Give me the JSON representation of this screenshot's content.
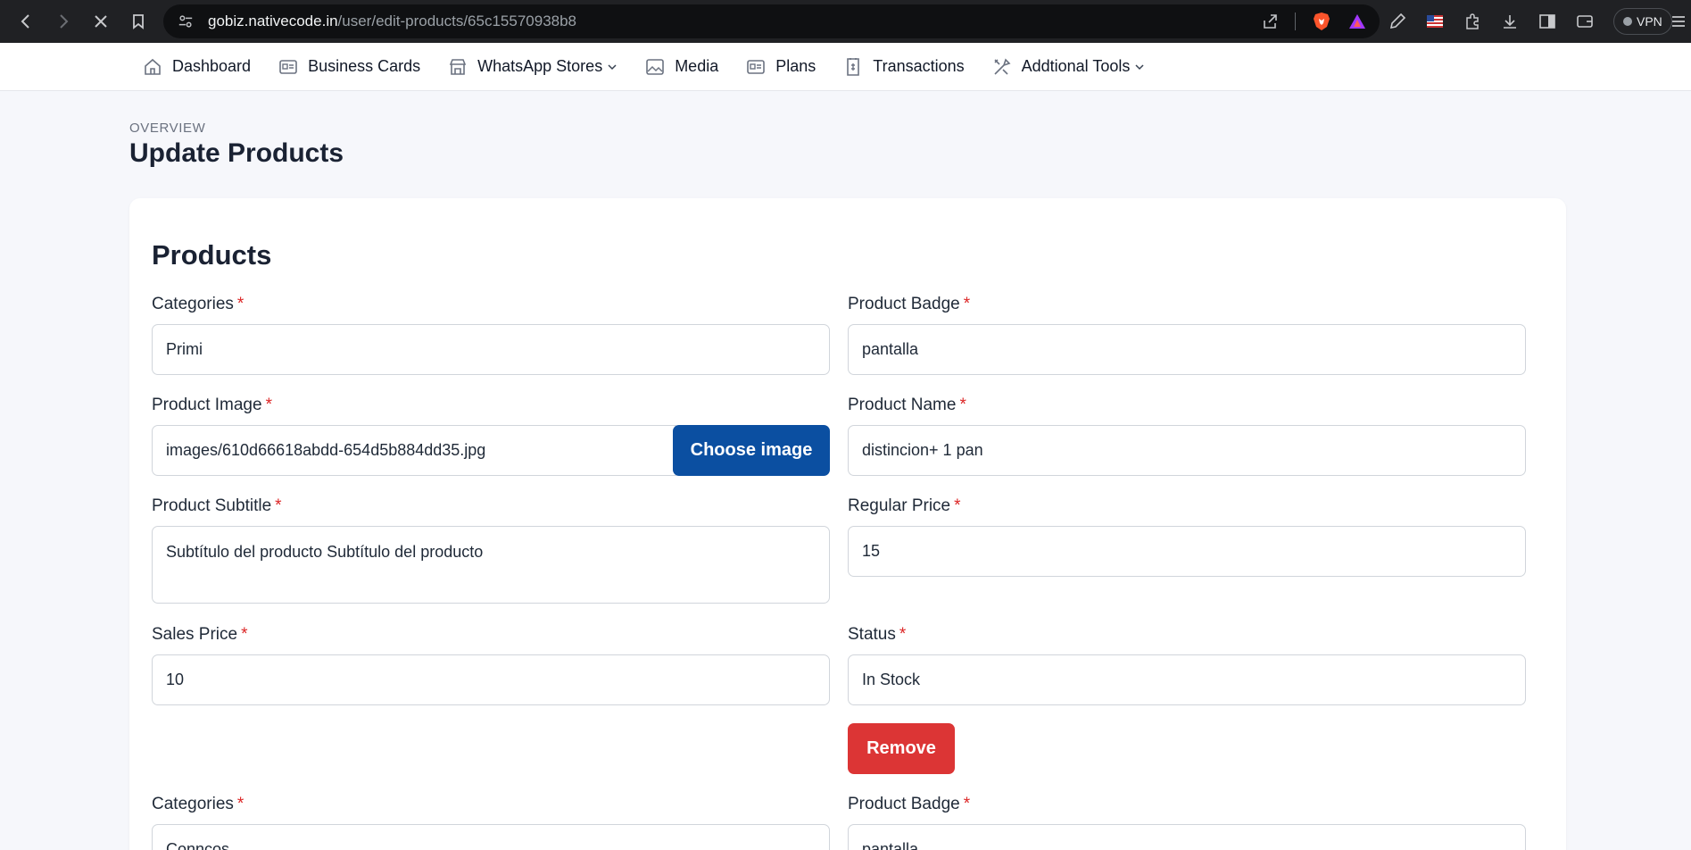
{
  "browser": {
    "url_host": "gobiz.nativecode.in",
    "url_path": "/user/edit-products/65c15570938b8",
    "vpn_label": "VPN"
  },
  "nav": {
    "items": [
      {
        "label": "Dashboard",
        "icon": "home-icon"
      },
      {
        "label": "Business Cards",
        "icon": "id-card-icon"
      },
      {
        "label": "WhatsApp Stores",
        "icon": "store-icon",
        "dropdown": true
      },
      {
        "label": "Media",
        "icon": "image-icon"
      },
      {
        "label": "Plans",
        "icon": "id-card-icon"
      },
      {
        "label": "Transactions",
        "icon": "receipt-icon"
      },
      {
        "label": "Addtional Tools",
        "icon": "tools-icon",
        "dropdown": true
      }
    ]
  },
  "header": {
    "overview": "OVERVIEW",
    "title": "Update Products"
  },
  "card": {
    "title": "Products",
    "required_mark": "*",
    "products": [
      {
        "categories_label": "Categories",
        "categories_value": "Primi",
        "badge_label": "Product Badge",
        "badge_value": "pantalla",
        "image_label": "Product Image",
        "image_value": "images/610d66618abdd-654d5b884dd35.jpg",
        "choose_image_label": "Choose image",
        "name_label": "Product Name",
        "name_value": "distincion+ 1 pan",
        "subtitle_label": "Product Subtitle",
        "subtitle_value": "Subtítulo del producto  Subtítulo del producto",
        "regular_price_label": "Regular Price",
        "regular_price_value": "15",
        "sales_price_label": "Sales Price",
        "sales_price_value": "10",
        "status_label": "Status",
        "status_value": "In Stock",
        "remove_label": "Remove"
      },
      {
        "categories_label": "Categories",
        "categories_value": "Conncos",
        "badge_label": "Product Badge",
        "badge_value": "pantalla"
      }
    ]
  },
  "colors": {
    "primary_button": "#0b4fa1",
    "danger_button": "#dc3535",
    "required": "#dc2626"
  }
}
